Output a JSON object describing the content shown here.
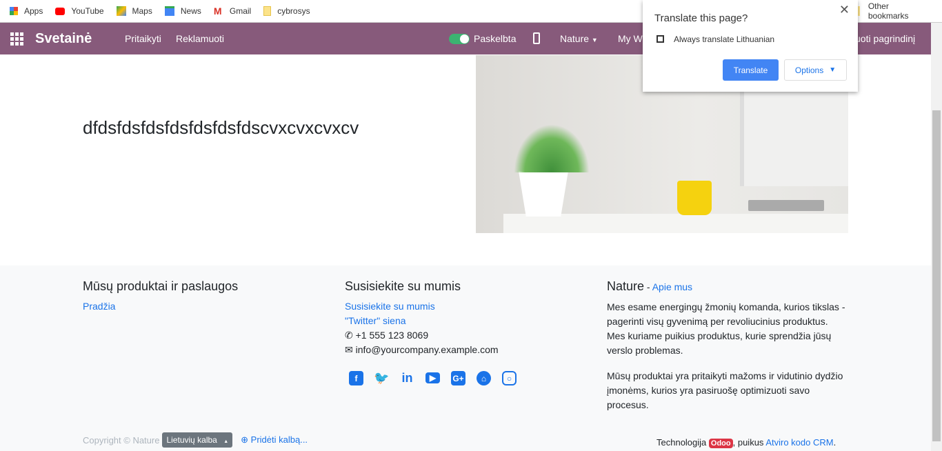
{
  "bookmarks": [
    {
      "label": "Apps",
      "icon": "apps-icon"
    },
    {
      "label": "YouTube",
      "icon": "youtube-icon"
    },
    {
      "label": "Maps",
      "icon": "maps-icon"
    },
    {
      "label": "News",
      "icon": "news-icon"
    },
    {
      "label": "Gmail",
      "icon": "gmail-icon"
    },
    {
      "label": "cybrosys",
      "icon": "folder-icon"
    }
  ],
  "other_bookmarks": "Other bookmarks",
  "navbar": {
    "brand": "Svetainė",
    "items": [
      "Pritaikyti",
      "Reklamuoti"
    ],
    "published": "Paskelbta",
    "published_on": true,
    "menu_nature": "Nature",
    "menu_mywebsite": "My We",
    "edit_main": "uoti pagrindinį",
    "color": "#875a7b"
  },
  "main": {
    "heading": "dfdsfdsfdsfdsfdsfdsfdscvxcvxcvxcv"
  },
  "footer": {
    "col1": {
      "title": "Mūsų produktai ir paslaugos",
      "links": [
        "Pradžia"
      ]
    },
    "col2": {
      "title": "Susisiekite su mumis",
      "links": [
        "Susisiekite su mumis",
        "\"Twitter\" siena"
      ],
      "phone": "+1 555 123 8069",
      "email": "info@yourcompany.example.com",
      "social": [
        "facebook-icon",
        "twitter-icon",
        "linkedin-icon",
        "youtube-icon",
        "google-plus-icon",
        "github-icon",
        "instagram-icon"
      ]
    },
    "col3": {
      "title": "Nature",
      "sep": " - ",
      "about": "Apie mus",
      "p1": "Mes esame energingų žmonių komanda, kurios tikslas - pagerinti visų gyvenimą per revoliucinius produktus. Mes kuriame puikius produktus, kurie sprendžia jūsų verslo problemas.",
      "p2": "Mūsų produktai yra pritaikyti mažoms ir vidutinio dydžio įmonėms, kurios yra pasiruošę optimizuoti savo procesus."
    },
    "copyright": "Copyright © Nature",
    "language": "Lietuvių kalba",
    "add_language": "Pridėti kalbą...",
    "tech": "Technologija",
    "odoo": "Odoo",
    "tech_mid": ", puikus",
    "crm": "Atviro kodo CRM",
    "dot": "."
  },
  "translate_popup": {
    "title": "Translate this page?",
    "checkbox_label": "Always translate Lithuanian",
    "checked": false,
    "translate": "Translate",
    "options": "Options"
  }
}
